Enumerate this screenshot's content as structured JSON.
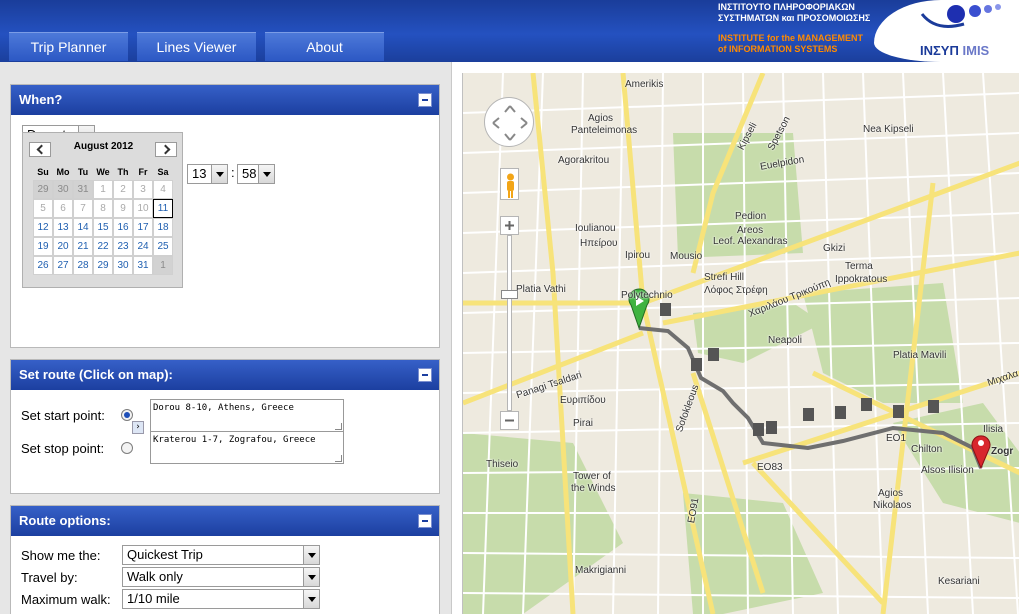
{
  "header": {
    "tabs": [
      "Trip Planner",
      "Lines Viewer",
      "About"
    ],
    "brand_greek": [
      "ΙΝΣΤΙΤΟΥΤΟ ΠΛΗΡΟΦΟΡΙΑΚΩΝ",
      "ΣΥΣΤΗΜΑΤΩΝ και ΠΡΟΣΟΜΟΙΩΣΗΣ"
    ],
    "brand_english": [
      "INSTITUTE for the MANAGEMENT",
      "of INFORMATION SYSTEMS"
    ],
    "logo_text_gr": "ΙΝΣΥΠ",
    "logo_text_en": "IMIS"
  },
  "when": {
    "title": "When?",
    "mode": "Depart",
    "calendar": {
      "month_label": "August 2012",
      "weekdays": [
        "Su",
        "Mo",
        "Tu",
        "We",
        "Th",
        "Fr",
        "Sa"
      ],
      "weeks": [
        [
          "29",
          "30",
          "31",
          "1",
          "2",
          "3",
          "4"
        ],
        [
          "5",
          "6",
          "7",
          "8",
          "9",
          "10",
          "11"
        ],
        [
          "12",
          "13",
          "14",
          "15",
          "16",
          "17",
          "18"
        ],
        [
          "19",
          "20",
          "21",
          "22",
          "23",
          "24",
          "25"
        ],
        [
          "26",
          "27",
          "28",
          "29",
          "30",
          "31",
          "1"
        ]
      ],
      "selected_day": "11"
    },
    "hour": "13",
    "minute": "58",
    "time_separator": ":"
  },
  "route": {
    "title": "Set route (Click on map):",
    "start_label": "Set start point:",
    "stop_label": "Set stop point:",
    "start_value": "Dorou 8-10, Athens, Greece",
    "stop_value": "Kraterou 1-7, Zografou, Greece",
    "active_point": "start"
  },
  "options": {
    "title": "Route options:",
    "show_me_label": "Show me the:",
    "show_me_value": "Quickest Trip",
    "travel_by_label": "Travel by:",
    "travel_by_value": "Walk only",
    "max_walk_label": "Maximum walk:",
    "max_walk_value": "1/10 mile"
  },
  "map": {
    "colors": {
      "road_major": "#f7e37a",
      "road_minor": "#ffffff",
      "park": "#c7dcab",
      "route": "#6f6f6f",
      "start_pin": "#3fb33f",
      "end_pin": "#d8262d"
    },
    "labels": [
      "Amerikis",
      "Agios",
      "Panteleimonas",
      "Agorakritou",
      "Ioulianou",
      "Ηπείρου",
      "Ipirou",
      "Mousio",
      "Pedion",
      "Areos",
      "Leof. Alexandras",
      "Gkizi",
      "Terma",
      "Ippokratous",
      "Nea Kipseli",
      "Strefi Hill",
      "Λόφος Στρέφη",
      "Neapoli",
      "Platia Mavili",
      "Platia Vathi",
      "Polytechnio",
      "Panagi Tsaldari",
      "Ευριπίδου",
      "Sofokleous",
      "Pirai",
      "Thiseio",
      "Tower of",
      "the Winds",
      "Chilton",
      "Alsos Ilision",
      "Agios",
      "Nikolaos",
      "Makrigianni",
      "Kesariani",
      "Ilisia",
      "Zogr",
      "EO83",
      "EO1",
      "EO91",
      "Kipseli",
      "Spetson",
      "Euelpidon",
      "Χαριλάου Τρικούπη",
      "Μιχαλα"
    ]
  }
}
